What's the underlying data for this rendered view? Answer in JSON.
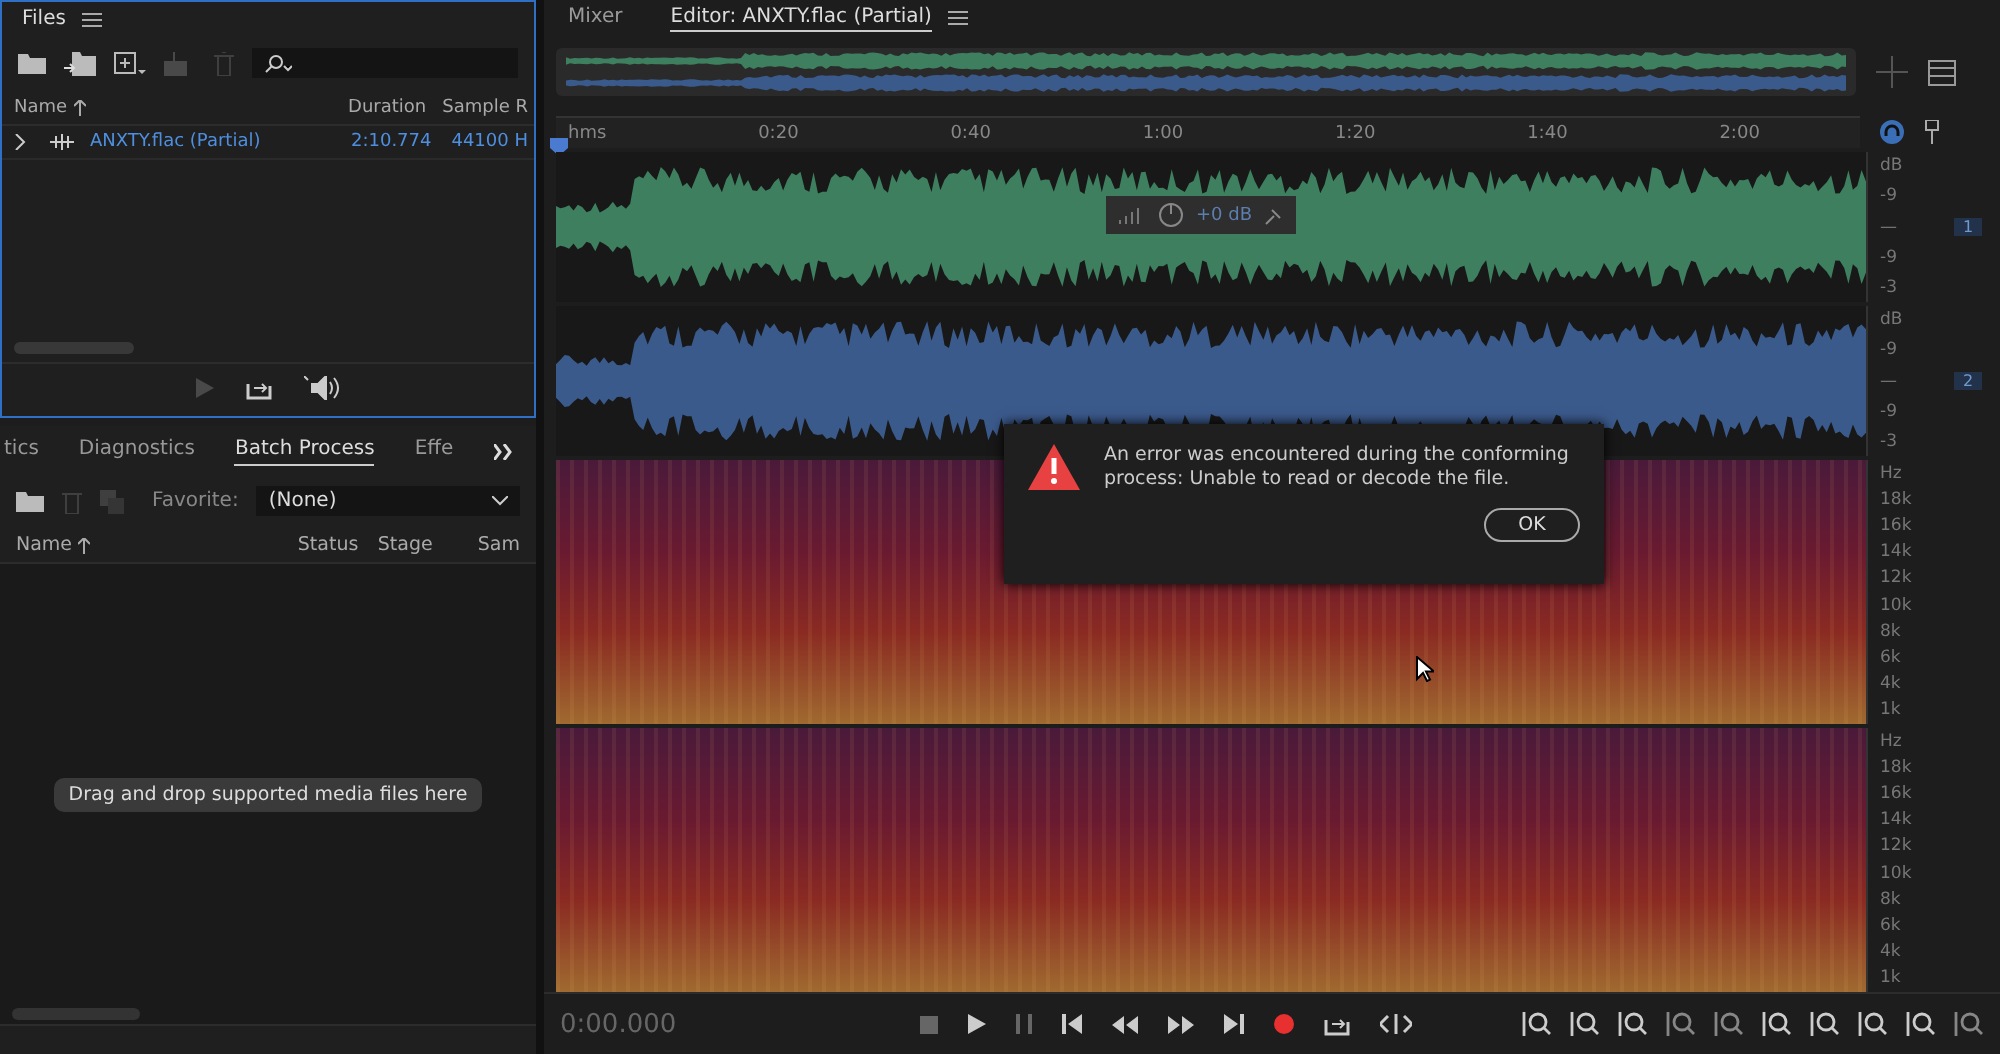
{
  "files_panel": {
    "title": "Files",
    "columns": [
      "Name",
      "Duration",
      "Sample R"
    ],
    "rows": [
      {
        "name": "ANXTY.flac (Partial)",
        "duration": "2:10.774",
        "sample_rate": "44100 H",
        "expanded": false
      }
    ]
  },
  "batch_panel": {
    "tabs": [
      {
        "label": "tics",
        "selected": false
      },
      {
        "label": "Diagnostics",
        "selected": false
      },
      {
        "label": "Batch Process",
        "selected": true
      },
      {
        "label": "Effe",
        "selected": false
      }
    ],
    "favorite_label": "Favorite:",
    "favorite_value": "(None)",
    "columns": [
      "Name",
      "Status",
      "Stage",
      "Sam"
    ],
    "hint": "Drag and drop supported media files here"
  },
  "editor": {
    "tabs": [
      {
        "label": "Mixer",
        "selected": false
      },
      {
        "label": "Editor: ANXTY.flac (Partial)",
        "selected": true
      }
    ],
    "ruler": [
      "hms",
      "0:20",
      "0:40",
      "1:00",
      "1:20",
      "1:40",
      "2:00"
    ],
    "hud_reading": "+0 dB",
    "channels": [
      {
        "number": "1",
        "color": "#3d7f5e",
        "scale": [
          "dB",
          "-9",
          "—",
          "-9",
          "-3"
        ]
      },
      {
        "number": "2",
        "color": "#3b5a8c",
        "scale": [
          "dB",
          "-9",
          "—",
          "-9",
          "-3"
        ]
      }
    ],
    "spectrograms": [
      {
        "scale": [
          "Hz",
          "18k",
          "16k",
          "14k",
          "12k",
          "10k",
          "8k",
          "6k",
          "4k",
          "1k"
        ]
      },
      {
        "scale": [
          "Hz",
          "18k",
          "16k",
          "14k",
          "12k",
          "10k",
          "8k",
          "6k",
          "4k",
          "1k"
        ]
      }
    ],
    "time": "0:00.000"
  },
  "dialog": {
    "message": "An error was encountered during the conforming process: Unable to read or decode the file.",
    "button": "OK"
  }
}
